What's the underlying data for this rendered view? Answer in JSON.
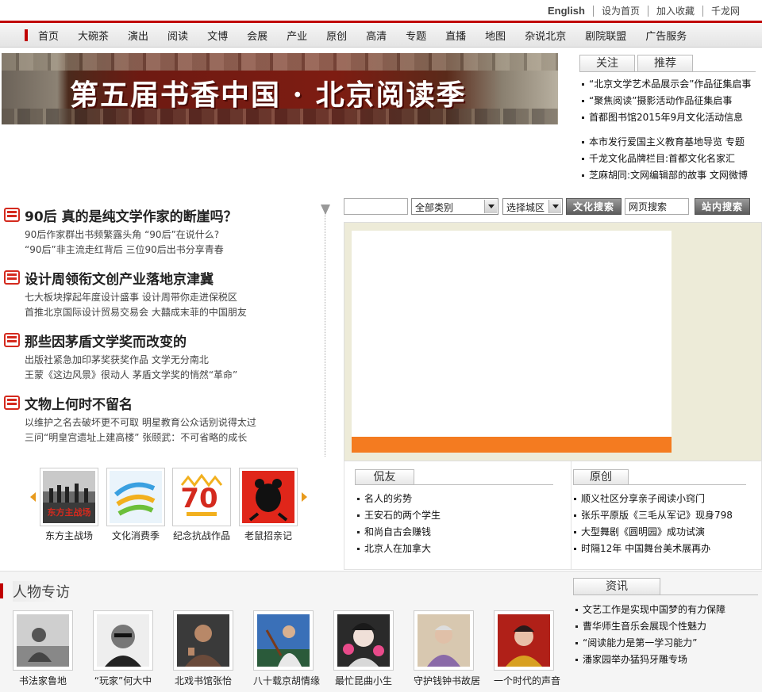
{
  "top_links": [
    "English",
    "设为首页",
    "加入收藏",
    "千龙网"
  ],
  "nav": [
    "首页",
    "大碗茶",
    "演出",
    "阅读",
    "文博",
    "会展",
    "产业",
    "原创",
    "高清",
    "专题",
    "直播",
    "地图",
    "杂说北京",
    "剧院联盟",
    "广告服务"
  ],
  "banner": {
    "title": "第五届书香中国 · 北京阅读季"
  },
  "right_tabs": [
    "关注",
    "推荐"
  ],
  "focus_list": [
    "“北京文学艺术品展示会”作品征集启事",
    "“聚焦阅读”摄影活动作品征集启事",
    "首都图书馆2015年9月文化活动信息"
  ],
  "focus_list2": [
    "本市发行爱国主义教育基地导览 专题",
    "千龙文化品牌栏目:首都文化名家汇",
    "芝麻胡同:文网编辑部的故事 文网微博"
  ],
  "headlines": [
    {
      "title": "90后  真的是纯文学作家的断崖吗？",
      "sub1": "90后作家群出书频繁露头角  “90后”在说什么?",
      "sub2": "“90后”非主流走红背后    三位90后出书分享青春"
    },
    {
      "title": "设计周领衔文创产业落地京津冀",
      "sub1": "七大板块撑起年度设计盛事  设计周带你走进保税区",
      "sub2": "首推北京国际设计贸易交易会 大囍成末菲的中国朋友"
    },
    {
      "title": "那些因茅盾文学奖而改变的",
      "sub1": "出版社紧急加印茅奖获奖作品 文学无分南北",
      "sub2": "王蒙《这边风景》很动人 茅盾文学奖的悄然“革命”"
    },
    {
      "title": "文物上何时不留名",
      "sub1": "以维护之名去破坏更不可取  明星教育公众话别说得太过",
      "sub2": "三问“明皇宫遗址上建高楼”  张颐武：不可省略的成长"
    }
  ],
  "search": {
    "keyword_value": "",
    "category": "全部类别",
    "city": "选择城区",
    "culture_btn": "文化搜索",
    "web_value": "网页搜索",
    "site_btn": "站内搜索"
  },
  "thumbs": [
    "东方主战场",
    "文化消费季",
    "纪念抗战作品",
    "老鼠招亲记"
  ],
  "kanyou": {
    "tab": "侃友",
    "items": [
      "名人的劣势",
      "王安石的两个学生",
      "和尚自古会赚钱",
      "北京人在加拿大"
    ]
  },
  "yuanchuang": {
    "tab": "原创",
    "items": [
      "顺义社区分享亲子阅读小窍门",
      "张乐平原版《三毛从军记》现身798",
      "大型舞剧《圆明园》成功试演",
      "时隔12年 中国舞台美术展再办"
    ]
  },
  "people": {
    "title": "人物专访",
    "items": [
      "书法家鲁地",
      "“玩家”何大中",
      "北戏书馆张怡",
      "八十载京胡情缘",
      "最忙昆曲小生",
      "守护钱钟书故居",
      "一个时代的声音"
    ]
  },
  "zixun": {
    "tab": "资讯",
    "items": [
      "文艺工作是实现中国梦的有力保障",
      "曹华师生音乐会展现个性魅力",
      "“阅读能力是第一学习能力”",
      "潘家园举办猛犸牙雕专场"
    ]
  },
  "colors": {
    "brand_red": "#c00000",
    "accent_orange": "#f47b20",
    "panel_bg": "#edebd8"
  }
}
